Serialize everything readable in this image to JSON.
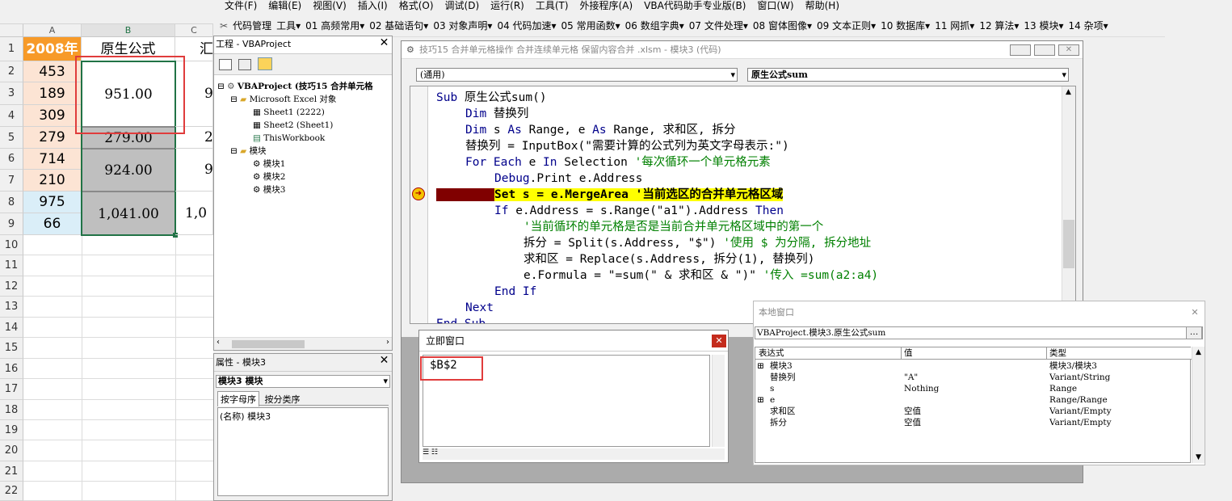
{
  "excel": {
    "columns": [
      "A",
      "B",
      "C"
    ],
    "rows": [
      "1",
      "2",
      "3",
      "4",
      "5",
      "6",
      "7",
      "8",
      "9",
      "10",
      "11",
      "12",
      "13",
      "14",
      "15",
      "16",
      "17",
      "18",
      "19",
      "20",
      "21",
      "22"
    ],
    "header": {
      "a": "2008年",
      "b": "原生公式",
      "c": "汇"
    },
    "col_a_values": [
      "453",
      "189",
      "309",
      "279",
      "714",
      "210",
      "975",
      "66"
    ],
    "col_b_merged": [
      "951.00",
      "279.00",
      "924.00",
      "1,041.00"
    ],
    "col_c_values": [
      "9",
      "2",
      "9",
      "1,0"
    ]
  },
  "vbe": {
    "menu": [
      "文件(F)",
      "编辑(E)",
      "视图(V)",
      "插入(I)",
      "格式(O)",
      "调试(D)",
      "运行(R)",
      "工具(T)",
      "外接程序(A)",
      "VBA代码助手专业版(B)",
      "窗口(W)",
      "帮助(H)"
    ],
    "toolbar": [
      "代码管理",
      "工具▾",
      "01 高频常用▾",
      "02 基础语句▾",
      "03 对象声明▾",
      "04 代码加速▾",
      "05 常用函数▾",
      "06 数组字典▾",
      "07 文件处理▾",
      "08 窗体图像▾",
      "09 文本正则▾",
      "10 数据库▾",
      "11 网抓▾",
      "12 算法▾",
      "13 模块▾",
      "14 杂项▾"
    ],
    "project": {
      "title": "工程 - VBAProject",
      "root": "VBAProject (技巧15  合并单元格",
      "excel_objects": "Microsoft Excel 对象",
      "sheets": [
        "Sheet1 (2222)",
        "Sheet2 (Sheet1)",
        "ThisWorkbook"
      ],
      "modules_folder": "模块",
      "modules": [
        "模块1",
        "模块2",
        "模块3"
      ]
    },
    "properties": {
      "title": "属性 - 模块3",
      "object_selector": "模块3 模块",
      "tabs": [
        "按字母序",
        "按分类序"
      ],
      "name_row": "(名称) 模块3"
    },
    "code_window": {
      "title": "技巧15  合并单元格操作  合并连续单元格  保留内容合并 .xlsm - 模块3 (代码)",
      "object_dropdown": "(通用)",
      "proc_dropdown": "原生公式sum",
      "lines": [
        {
          "indent": 0,
          "parts": [
            [
              "kw",
              "Sub "
            ],
            [
              "",
              "原生公式sum()"
            ]
          ]
        },
        {
          "indent": 1,
          "parts": [
            [
              "kw",
              "Dim "
            ],
            [
              "",
              "替换列"
            ]
          ]
        },
        {
          "indent": 1,
          "parts": [
            [
              "kw",
              "Dim "
            ],
            [
              "",
              "s "
            ],
            [
              "kw",
              "As "
            ],
            [
              "",
              "Range, e "
            ],
            [
              "kw",
              "As "
            ],
            [
              "",
              "Range, 求和区, 拆分"
            ]
          ]
        },
        {
          "indent": 1,
          "parts": [
            [
              "",
              "替换列 = InputBox(\"需要计算的公式列为英文字母表示:\")"
            ]
          ]
        },
        {
          "indent": 1,
          "parts": [
            [
              "kw",
              "For Each "
            ],
            [
              "",
              "e "
            ],
            [
              "kw",
              "In "
            ],
            [
              "",
              "Selection "
            ],
            [
              "cm",
              "'每次循环一个单元格元素"
            ]
          ]
        },
        {
          "indent": 2,
          "parts": [
            [
              "kw",
              "Debug"
            ],
            [
              "",
              ".Print e.Address"
            ]
          ]
        },
        {
          "indent": 2,
          "parts": [
            [
              "hl",
              "Set s = e.MergeArea '当前选区的合并单元格区域"
            ]
          ]
        },
        {
          "indent": 2,
          "parts": [
            [
              "kw",
              "If "
            ],
            [
              "",
              "e.Address = s.Range(\"a1\").Address "
            ],
            [
              "kw",
              "Then"
            ]
          ]
        },
        {
          "indent": 3,
          "parts": [
            [
              "cm",
              "'当前循环的单元格是否是当前合并单元格区域中的第一个"
            ]
          ]
        },
        {
          "indent": 3,
          "parts": [
            [
              "",
              "拆分 = Split(s.Address, \"$\") "
            ],
            [
              "cm",
              "'使用 $ 为分隔, 拆分地址"
            ]
          ]
        },
        {
          "indent": 3,
          "parts": [
            [
              "",
              "求和区 = Replace(s.Address, 拆分(1), 替换列)"
            ]
          ]
        },
        {
          "indent": 3,
          "parts": [
            [
              "",
              "e.Formula = \"=sum(\" & 求和区 & \")\" "
            ],
            [
              "cm",
              "'传入 =sum(a2:a4)"
            ]
          ]
        },
        {
          "indent": 2,
          "parts": [
            [
              "kw",
              "End If"
            ]
          ]
        },
        {
          "indent": 1,
          "parts": [
            [
              "kw",
              "Next"
            ]
          ]
        },
        {
          "indent": 0,
          "parts": [
            [
              "kw",
              "End Sub"
            ]
          ]
        }
      ]
    },
    "immediate": {
      "title": "立即窗口",
      "output": "$B$2"
    },
    "locals": {
      "title": "本地窗口",
      "context": "VBAProject.模块3.原生公式sum",
      "headers": [
        "表达式",
        "值",
        "类型"
      ],
      "rows": [
        [
          "⊞",
          "模块3",
          "",
          "模块3/模块3"
        ],
        [
          "",
          "替换列",
          "\"A\"",
          "Variant/String"
        ],
        [
          "",
          "s",
          "Nothing",
          "Range"
        ],
        [
          "⊞",
          "e",
          "",
          "Range/Range"
        ],
        [
          "",
          "求和区",
          "空值",
          "Variant/Empty"
        ],
        [
          "",
          "拆分",
          "空值",
          "Variant/Empty"
        ]
      ]
    },
    "colors": {
      "header_orange": "#f79a28",
      "peach": "#fce4d4",
      "blue": "#daeef8",
      "gray": "#bfbfbf",
      "highlight": "#ffff00",
      "breakpoint": "#800000",
      "red_box": "#e03c3c"
    }
  }
}
